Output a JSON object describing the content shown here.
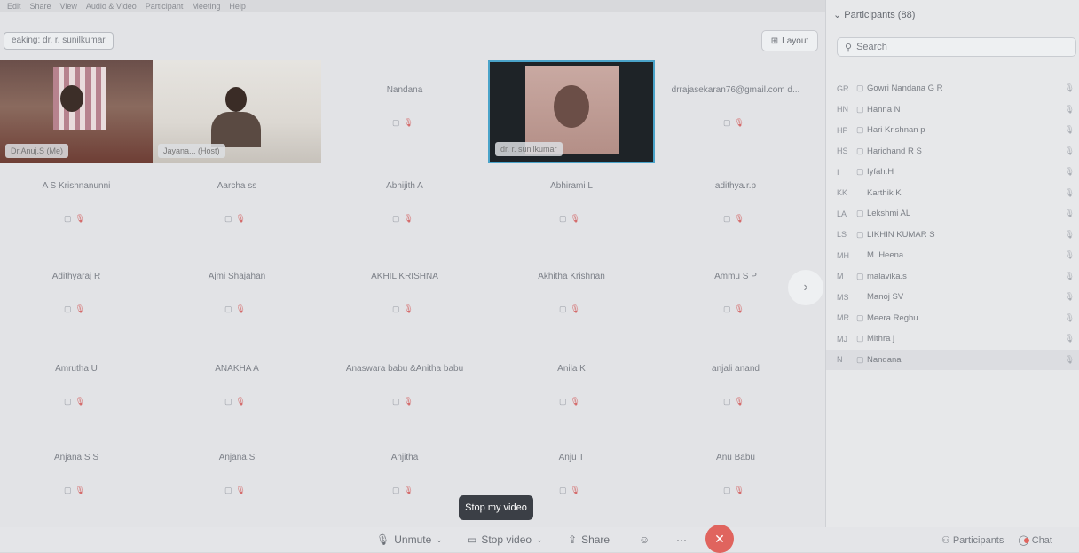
{
  "menu": [
    "Edit",
    "Share",
    "View",
    "Audio & Video",
    "Participant",
    "Meeting",
    "Help"
  ],
  "speaking_label": "eaking: dr. r. sunilkumar",
  "layout_label": "Layout",
  "tiles": [
    {
      "name": "Dr.Anuj.S (Me)",
      "type": "video",
      "variant": "v1"
    },
    {
      "name": "Jayana... (Host)",
      "type": "video",
      "variant": "v2"
    },
    {
      "name": "Nandana",
      "type": "name"
    },
    {
      "name": "dr. r. sunilkumar",
      "type": "video",
      "variant": "v4"
    },
    {
      "name": "drrajasekaran76@gmail.com d...",
      "type": "name"
    },
    {
      "name": "A S Krishnanunni",
      "type": "name"
    },
    {
      "name": "Aarcha ss",
      "type": "name"
    },
    {
      "name": "Abhijith A",
      "type": "name"
    },
    {
      "name": "Abhirami L",
      "type": "name"
    },
    {
      "name": "adithya.r.p",
      "type": "name"
    },
    {
      "name": "Adithyaraj R",
      "type": "name"
    },
    {
      "name": "Ajmi Shajahan",
      "type": "name"
    },
    {
      "name": "AKHIL KRISHNA",
      "type": "name"
    },
    {
      "name": "Akhitha Krishnan",
      "type": "name"
    },
    {
      "name": "Ammu S P",
      "type": "name"
    },
    {
      "name": "Amrutha U",
      "type": "name"
    },
    {
      "name": "ANAKHA A",
      "type": "name"
    },
    {
      "name": "Anaswara babu &Anitha babu",
      "type": "name"
    },
    {
      "name": "Anila K",
      "type": "name"
    },
    {
      "name": "anjali anand",
      "type": "name"
    },
    {
      "name": "Anjana S S",
      "type": "name"
    },
    {
      "name": "Anjana.S",
      "type": "name"
    },
    {
      "name": "Anjitha",
      "type": "name"
    },
    {
      "name": "Anju T",
      "type": "name"
    },
    {
      "name": "Anu Babu",
      "type": "name"
    }
  ],
  "tooltip": "Stop my video",
  "toolbar": {
    "unmute": "Unmute",
    "stop_video": "Stop video",
    "share": "Share",
    "more": "···",
    "end": "✕"
  },
  "panel": {
    "title": "Participants (88)",
    "search_placeholder": "Search",
    "participants": [
      {
        "initials": "GR",
        "name": "Gowri Nandana G R",
        "cam": true
      },
      {
        "initials": "HN",
        "name": "Hanna N",
        "cam": true
      },
      {
        "initials": "HP",
        "name": "Hari Krishnan p",
        "cam": true
      },
      {
        "initials": "HS",
        "name": "Harichand R S",
        "cam": true
      },
      {
        "initials": "I",
        "name": "Iyfah.H",
        "cam": true
      },
      {
        "initials": "KK",
        "name": "Karthik K",
        "cam": false
      },
      {
        "initials": "LA",
        "name": "Lekshmi AL",
        "cam": true
      },
      {
        "initials": "LS",
        "name": "LIKHIN KUMAR S",
        "cam": true
      },
      {
        "initials": "MH",
        "name": "M. Heena",
        "cam": false
      },
      {
        "initials": "M",
        "name": "malavika.s",
        "cam": true
      },
      {
        "initials": "MS",
        "name": "Manoj SV",
        "cam": false
      },
      {
        "initials": "MR",
        "name": "Meera Reghu",
        "cam": true
      },
      {
        "initials": "MJ",
        "name": "Mithra j",
        "cam": true
      },
      {
        "initials": "N",
        "name": "Nandana",
        "cam": true
      }
    ],
    "footer_participants": "Participants",
    "footer_chat": "Chat"
  },
  "colors": {
    "end_button": "#e0645e",
    "active_speaker_border": "#4aa3c9"
  }
}
